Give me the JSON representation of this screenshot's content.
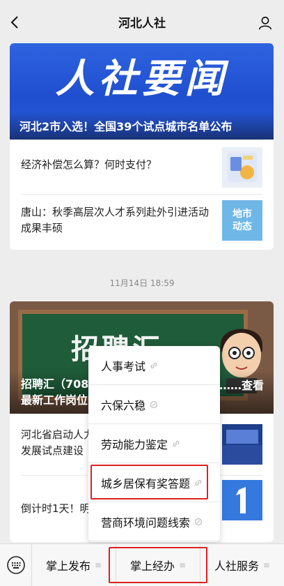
{
  "header": {
    "title": "河北人社"
  },
  "feed": {
    "card1": {
      "hero_text": "人社要闻",
      "hero_caption": "河北2市入选！全国39个试点城市名单公布",
      "items": [
        {
          "text": "经济补偿怎么算？何时支付？"
        },
        {
          "text": "唐山：秋季高层次人才系列赴外引进活动成果丰硕",
          "thumb_text": "地市\n动态"
        }
      ]
    },
    "timestamp": "11月14日 18:59",
    "card2": {
      "board_text": "招聘汇",
      "caption_line1": "招聘汇（708",
      "caption_line2": "最新工作岗位",
      "caption_more": "……查看",
      "items": [
        {
          "text": "河北省启动人力\n发展试点建设"
        },
        {
          "text": "倒计时1天！明"
        }
      ]
    }
  },
  "popup_menu": {
    "items": [
      {
        "label": "人事考试"
      },
      {
        "label": "六保六稳"
      },
      {
        "label": "劳动能力鉴定"
      },
      {
        "label": "城乡居保有奖答题"
      },
      {
        "label": "营商环境问题线索"
      }
    ]
  },
  "bottom_menu": {
    "tabs": [
      {
        "label": "掌上发布"
      },
      {
        "label": "掌上经办"
      },
      {
        "label": "人社服务"
      }
    ]
  },
  "colors": {
    "highlight": "#e02020",
    "hero_blue": "#2a5ad8"
  },
  "icons": [
    "back-chevron-icon",
    "profile-icon",
    "keyboard-icon",
    "link-icon",
    "menu-lines-icon"
  ]
}
